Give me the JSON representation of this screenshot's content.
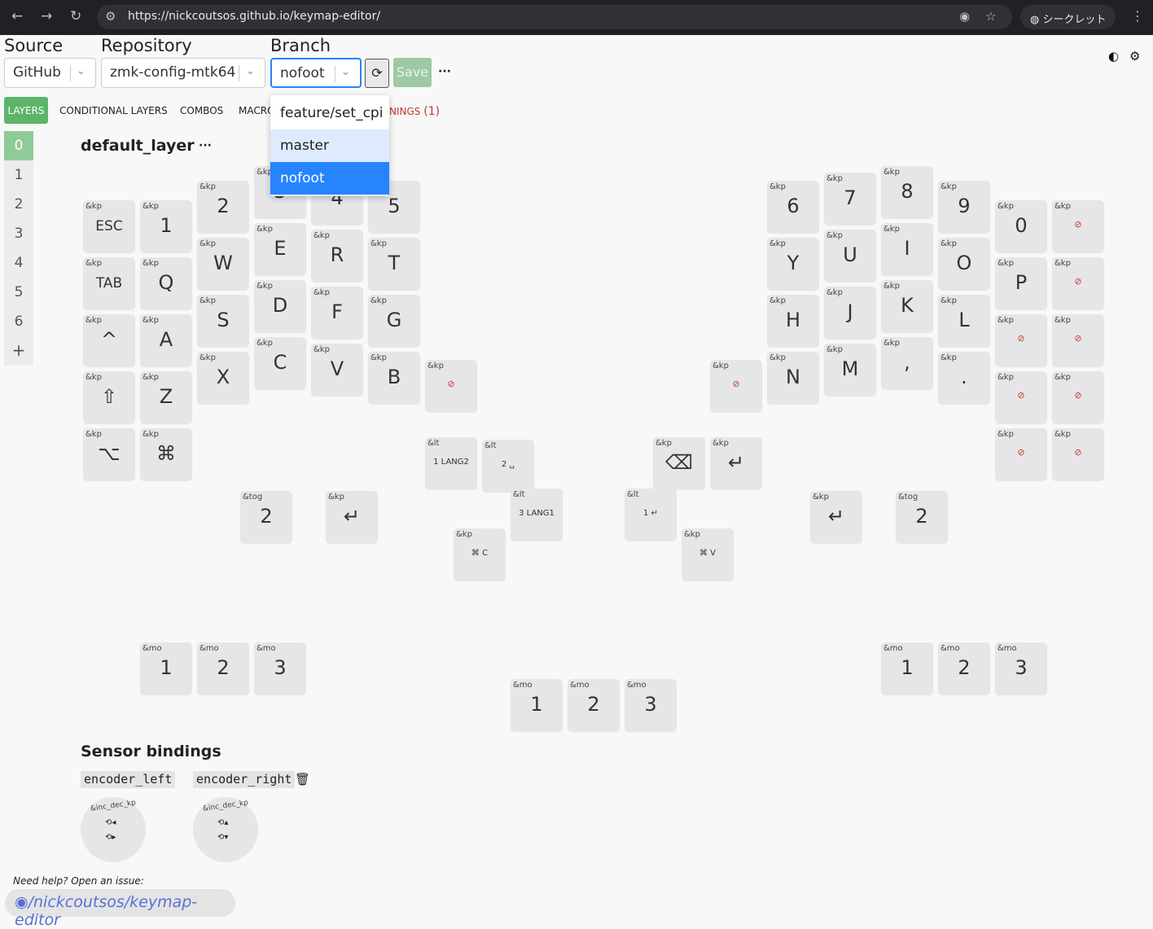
{
  "browser": {
    "url": "https://nickcoutsos.github.io/keymap-editor/",
    "incognito_label": "シークレット"
  },
  "toolbar": {
    "source_label": "Source",
    "source_value": "GitHub",
    "repository_label": "Repository",
    "repository_value": "zmk-config-mtk64",
    "branch_label": "Branch",
    "branch_value": "nofoot",
    "save_label": "Save",
    "more_label": "···"
  },
  "tabs": {
    "layers": "LAYERS",
    "conditional_layers": "CONDITIONAL LAYERS",
    "combos": "COMBOS",
    "macros": "MACRO",
    "bindings": "NINGS",
    "bindings_count": "(1)"
  },
  "branch_dropdown": {
    "options": [
      "feature/set_cpi",
      "master",
      "nofoot"
    ],
    "hovered": "master",
    "selected": "nofoot"
  },
  "layer_list": {
    "items": [
      "0",
      "1",
      "2",
      "3",
      "4",
      "5",
      "6"
    ],
    "add_label": "+",
    "active": "0"
  },
  "layer": {
    "name": "default_layer",
    "more_label": "···"
  },
  "keys": [
    {
      "b": "&kp",
      "p": "ESC"
    },
    {
      "b": "&kp",
      "p": "1"
    },
    {
      "b": "&kp",
      "p": "2"
    },
    {
      "b": "&kp",
      "p": "3"
    },
    {
      "b": "&kp",
      "p": "4"
    },
    {
      "b": "&kp",
      "p": "5"
    },
    {
      "b": "&kp",
      "p": "TAB"
    },
    {
      "b": "&kp",
      "p": "Q"
    },
    {
      "b": "&kp",
      "p": "W"
    },
    {
      "b": "&kp",
      "p": "E"
    },
    {
      "b": "&kp",
      "p": "R"
    },
    {
      "b": "&kp",
      "p": "T"
    },
    {
      "b": "&kp",
      "p": "^"
    },
    {
      "b": "&kp",
      "p": "A"
    },
    {
      "b": "&kp",
      "p": "S"
    },
    {
      "b": "&kp",
      "p": "D"
    },
    {
      "b": "&kp",
      "p": "F"
    },
    {
      "b": "&kp",
      "p": "G"
    },
    {
      "b": "&kp",
      "p": "⇧"
    },
    {
      "b": "&kp",
      "p": "Z"
    },
    {
      "b": "&kp",
      "p": "X"
    },
    {
      "b": "&kp",
      "p": "C"
    },
    {
      "b": "&kp",
      "p": "V"
    },
    {
      "b": "&kp",
      "p": "B"
    },
    {
      "b": "&kp",
      "p": "⊘"
    },
    {
      "b": "&kp",
      "p": "⌥"
    },
    {
      "b": "&kp",
      "p": "⌘"
    },
    {
      "b": "&lt",
      "p": "1 LANG2"
    },
    {
      "b": "&lt",
      "p": "2 ␣"
    },
    {
      "b": "&lt",
      "p": "3 LANG1"
    },
    {
      "b": "&tog",
      "p": "2"
    },
    {
      "b": "&kp",
      "p": "↵"
    },
    {
      "b": "&kp",
      "p": "⌘ C"
    },
    {
      "b": "&kp",
      "p": "6"
    },
    {
      "b": "&kp",
      "p": "7"
    },
    {
      "b": "&kp",
      "p": "8"
    },
    {
      "b": "&kp",
      "p": "9"
    },
    {
      "b": "&kp",
      "p": "0"
    },
    {
      "b": "&kp",
      "p": "⊘"
    },
    {
      "b": "&kp",
      "p": "Y"
    },
    {
      "b": "&kp",
      "p": "U"
    },
    {
      "b": "&kp",
      "p": "I"
    },
    {
      "b": "&kp",
      "p": "O"
    },
    {
      "b": "&kp",
      "p": "P"
    },
    {
      "b": "&kp",
      "p": "⊘"
    },
    {
      "b": "&kp",
      "p": "H"
    },
    {
      "b": "&kp",
      "p": "J"
    },
    {
      "b": "&kp",
      "p": "K"
    },
    {
      "b": "&kp",
      "p": "L"
    },
    {
      "b": "&kp",
      "p": "⊘"
    },
    {
      "b": "&kp",
      "p": "⊘"
    },
    {
      "b": "&kp",
      "p": "⊘"
    },
    {
      "b": "&kp",
      "p": "N"
    },
    {
      "b": "&kp",
      "p": "M"
    },
    {
      "b": "&kp",
      "p": ","
    },
    {
      "b": "&kp",
      "p": "."
    },
    {
      "b": "&kp",
      "p": "⊘"
    },
    {
      "b": "&kp",
      "p": "⊘"
    },
    {
      "b": "&kp",
      "p": "⌫"
    },
    {
      "b": "&kp",
      "p": "↵"
    },
    {
      "b": "&kp",
      "p": "⊘"
    },
    {
      "b": "&kp",
      "p": "⊘"
    },
    {
      "b": "&lt",
      "p": "1 ↵"
    },
    {
      "b": "&kp",
      "p": "⌘ V"
    },
    {
      "b": "&kp",
      "p": "↵"
    },
    {
      "b": "&tog",
      "p": "2"
    },
    {
      "b": "&mo",
      "p": "1"
    },
    {
      "b": "&mo",
      "p": "2"
    },
    {
      "b": "&mo",
      "p": "3"
    },
    {
      "b": "&mo",
      "p": "1"
    },
    {
      "b": "&mo",
      "p": "2"
    },
    {
      "b": "&mo",
      "p": "3"
    },
    {
      "b": "&mo",
      "p": "1"
    },
    {
      "b": "&mo",
      "p": "2"
    },
    {
      "b": "&mo",
      "p": "3"
    }
  ],
  "sensors": {
    "title": "Sensor bindings",
    "left_label": "encoder_left",
    "right_label": "encoder_right",
    "left_binding": "&inc_dec_kp",
    "right_binding": "&inc_dec_kp",
    "left_ccw": "⟲◂",
    "left_cw": "⟲▸",
    "right_ccw": "⟲▴",
    "right_cw": "⟲▾"
  },
  "footer": {
    "help_text": "Need help? Open an issue:",
    "repo_link": "/nickcoutsos/keymap-editor"
  },
  "colors": {
    "accent_green": "#5cb46a",
    "dropdown_selected": "#2684ff",
    "dropdown_hover": "#deebff",
    "none_red": "#c0392b"
  }
}
